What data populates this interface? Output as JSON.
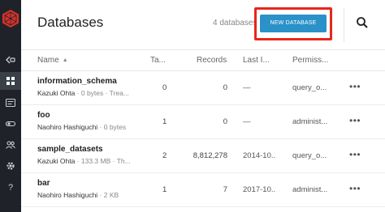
{
  "header": {
    "title": "Databases",
    "db_count": "4 databases",
    "new_database_label": "NEW DATABASE"
  },
  "columns": {
    "name": "Name",
    "tables": "Ta...",
    "records": "Records",
    "last": "Last I...",
    "permission": "Permiss..."
  },
  "rows": [
    {
      "name": "information_schema",
      "owner": "Kazuki Ohta",
      "meta": " · 0 bytes · Trea...",
      "tables": "0",
      "records": "0",
      "last": "—",
      "permission": "query_o..."
    },
    {
      "name": "foo",
      "owner": "Naohiro Hashiguchi",
      "meta": " · 0 bytes",
      "tables": "1",
      "records": "0",
      "last": "—",
      "permission": "administ..."
    },
    {
      "name": "sample_datasets",
      "owner": "Kazuki Ohta",
      "meta": " · 133.3 MB · Th...",
      "tables": "2",
      "records": "8,812,278",
      "last": "2014-10...",
      "permission": "query_o..."
    },
    {
      "name": "bar",
      "owner": "Naohiro Hashiguchi",
      "meta": " · 2 KB",
      "tables": "1",
      "records": "7",
      "last": "2017-10...",
      "permission": "administ..."
    }
  ],
  "more_label": "•••",
  "colors": {
    "sidebar_bg": "#1f2329",
    "logo_red": "#d8322a",
    "button_blue": "#2a91c9",
    "highlight_red": "#e8271a"
  },
  "icons": [
    "logo-icon",
    "collapse-icon",
    "databases-icon",
    "queries-icon",
    "connections-icon",
    "users-icon",
    "settings-icon",
    "help-icon",
    "search-icon",
    "sort-ascending-icon",
    "more-options-icon"
  ]
}
